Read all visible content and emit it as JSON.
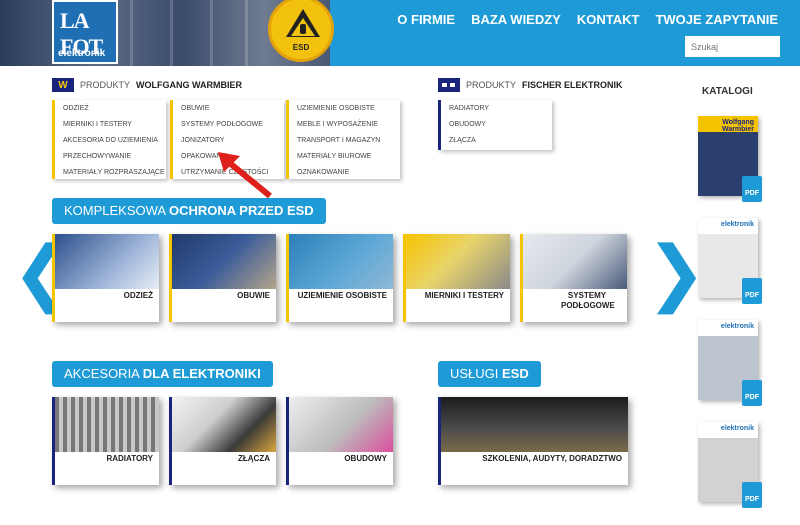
{
  "header": {
    "logo_top": "LA FOT",
    "logo_bottom": "elektronik",
    "esd_badge": "ESD",
    "nav": [
      "O FIRMIE",
      "BAZA WIEDZY",
      "KONTAKT",
      "TWOJE ZAPYTANIE"
    ],
    "search_placeholder": "Szukaj"
  },
  "brands": {
    "warmbier": {
      "prefix": "PRODUKTY",
      "name": "WOLFGANG WARMBIER",
      "logo": "W"
    },
    "fischer": {
      "prefix": "PRODUKTY",
      "name": "FISCHER ELEKTRONIK"
    }
  },
  "warmbier_cols": [
    [
      "ODZIEŻ",
      "MIERNIKI I TESTERY",
      "AKCESORIA DO UZIEMIENIA",
      "PRZECHOWYWANIE",
      "MATERIAŁY ROZPRASZAJĄCE"
    ],
    [
      "OBUWIE",
      "SYSTEMY PODŁOGOWE",
      "JONIZATORY",
      "OPAKOWANIA",
      "UTRZYMANIE CZYSTOŚCI"
    ],
    [
      "UZIEMIENIE OSOBISTE",
      "MEBLE I WYPOSAŻENIE",
      "TRANSPORT I MAGAZYN",
      "MATERIAŁY BIUROWE",
      "OZNAKOWANIE"
    ]
  ],
  "fischer_col": [
    "RADIATORY",
    "OBUDOWY",
    "ZŁĄCZA"
  ],
  "section_esd": {
    "prefix": "KOMPLEKSOWA ",
    "bold": "OCHRONA PRZED ESD"
  },
  "esd_tiles": [
    "ODZIEŻ",
    "OBUWIE",
    "UZIEMIENIE OSOBISTE",
    "MIERNIKI I TESTERY",
    "SYSTEMY PODŁOGOWE"
  ],
  "section_elec": {
    "prefix": "AKCESORIA ",
    "bold": "DLA ELEKTRONIKI"
  },
  "elec_tiles": [
    "RADIATORY",
    "ZŁĄCZA",
    "OBUDOWY"
  ],
  "section_services": {
    "prefix": "USŁUGI ",
    "bold": "ESD"
  },
  "service_tile": "SZKOLENIA, AUDYTY, DORADZTWO",
  "catalogs": {
    "title": "KATALOGI",
    "items": [
      "Wolfgang Warmbier",
      "elektronik",
      "elektronik",
      "elektronik"
    ],
    "pdf": "PDF"
  },
  "colors": {
    "accent": "#1e9ad6",
    "yellow": "#f5c400",
    "navy": "#1a237e"
  }
}
